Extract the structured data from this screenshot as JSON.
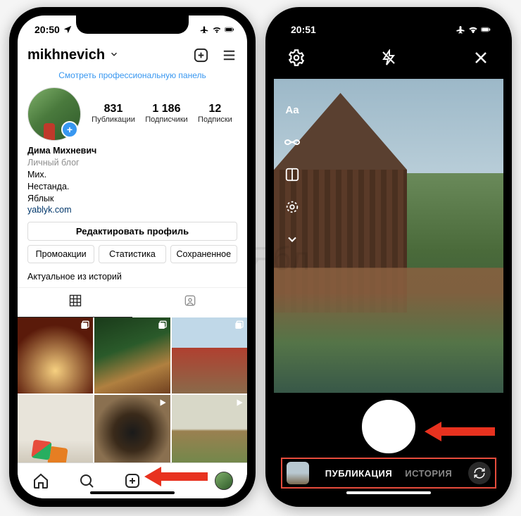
{
  "status": {
    "time_left": "20:50",
    "time_right": "20:51"
  },
  "left": {
    "username": "mikhnevich",
    "pro_link": "Смотреть профессиональную панель",
    "stats": {
      "posts": {
        "num": "831",
        "label": "Публикации"
      },
      "followers": {
        "num": "1 186",
        "label": "Подписчики"
      },
      "following": {
        "num": "12",
        "label": "Подписки"
      }
    },
    "bio": {
      "name": "Дима Михневич",
      "category": "Личный блог",
      "line1": "Мих.",
      "line2": "Нестанда.",
      "line3": "Яблык",
      "link": "yablyk.com"
    },
    "edit": "Редактировать профиль",
    "buttons": {
      "promo": "Промоакции",
      "stats": "Статистика",
      "saved": "Сохраненное"
    },
    "highlights_title": "Актуальное из историй"
  },
  "right": {
    "modes": {
      "post": "ПУБЛИКАЦИЯ",
      "story": "ИСТОРИЯ"
    },
    "tool_text": "Aa"
  },
  "watermark": "Ябл"
}
